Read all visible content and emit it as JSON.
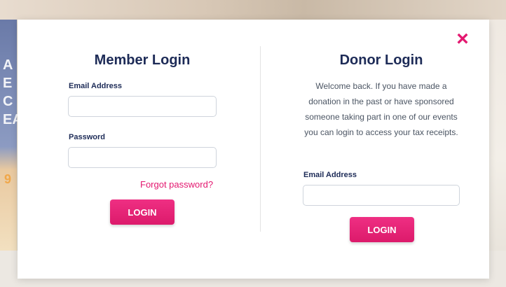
{
  "background": {
    "left_glyphs": [
      "A",
      "E",
      "C",
      "EA"
    ],
    "left_orange_glyph": "9"
  },
  "modal": {
    "close_icon": "×",
    "accent_color": "#e3176f",
    "heading_color": "#1d2b57"
  },
  "member_login": {
    "title": "Member Login",
    "email_label": "Email Address",
    "email_value": "",
    "password_label": "Password",
    "password_value": "",
    "forgot_password": "Forgot password?",
    "login_button": "LOGIN"
  },
  "donor_login": {
    "title": "Donor Login",
    "description": "Welcome back. If you have made a donation in the past or have sponsored someone taking part in one of our events you can login to access your tax receipts.",
    "email_label": "Email Address",
    "email_value": "",
    "login_button": "LOGIN"
  }
}
